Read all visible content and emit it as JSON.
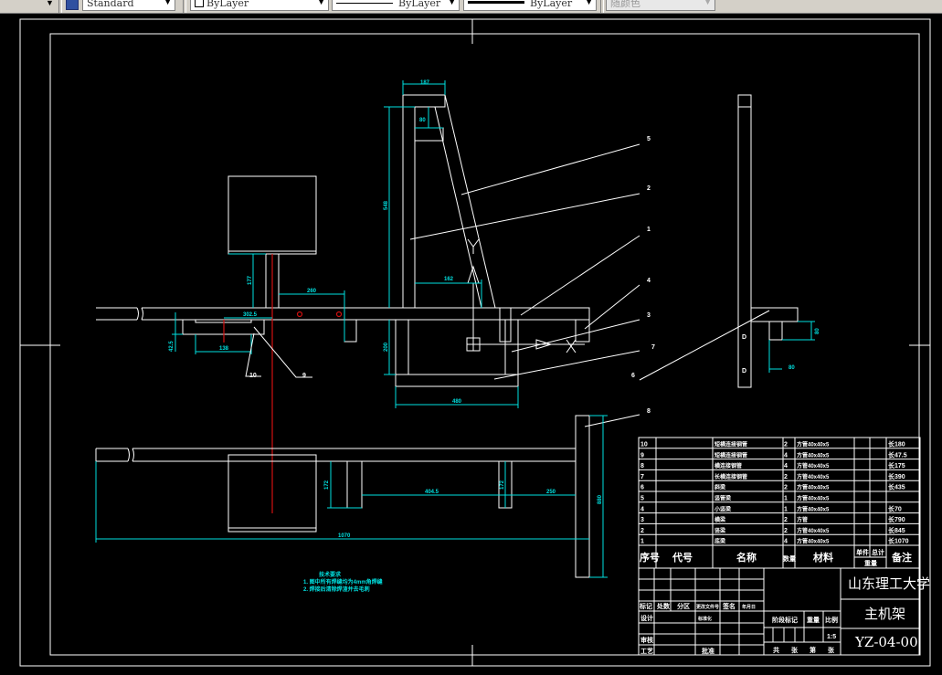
{
  "toolbar": {
    "text_style": "Standard",
    "layer": "ByLayer",
    "linetype": "ByLayer",
    "lineweight": "ByLayer",
    "plot_style": "随颜色"
  },
  "colors": {
    "background": "#000000",
    "object_lines": "#ffffff",
    "dimensions": "#00e0e0",
    "centerline": "#d01010",
    "toolbar": "#d4d0c8"
  },
  "dimensions": {
    "top_width": "187",
    "crossbar_gap": "80",
    "post_height": "548",
    "motor_post": "177",
    "motor_offset": "260",
    "brace_offset": "162",
    "lower_height": "200",
    "lower_width": "480",
    "left_offset": "302.5",
    "left_height": "42.5",
    "left_width": "138",
    "plan_post": "172",
    "plan_post2": "172",
    "plan_span": "404.5",
    "plan_end": "250",
    "plan_total": "1070",
    "plan_depth": "880",
    "side_height": "80",
    "side_width": "80"
  },
  "leaders": [
    "1",
    "2",
    "3",
    "4",
    "5",
    "6",
    "7",
    "8",
    "9",
    "10"
  ],
  "side_marks": [
    "D",
    "D"
  ],
  "notes": {
    "title": "技术要求",
    "items": [
      "1. 图中所有焊缝均为4mm角焊缝",
      "2. 焊接后清除焊渣并去毛刺"
    ]
  },
  "parts_list": {
    "rows": [
      {
        "no": "10",
        "code": "",
        "name": "短横连接钢管",
        "qty": "2",
        "material": "方管40x40x5",
        "unit": "",
        "total": "",
        "remark": "长180"
      },
      {
        "no": "9",
        "code": "",
        "name": "短横连接钢管",
        "qty": "4",
        "material": "方管40x40x5",
        "unit": "",
        "total": "",
        "remark": "长47.5"
      },
      {
        "no": "8",
        "code": "",
        "name": "横连接钢管",
        "qty": "4",
        "material": "方管40x40x5",
        "unit": "",
        "total": "",
        "remark": "长175"
      },
      {
        "no": "7",
        "code": "",
        "name": "长横连接钢管",
        "qty": "2",
        "material": "方管40x40x5",
        "unit": "",
        "total": "",
        "remark": "长390"
      },
      {
        "no": "6",
        "code": "",
        "name": "斜梁",
        "qty": "2",
        "material": "方管40x40x5",
        "unit": "",
        "total": "",
        "remark": "长435"
      },
      {
        "no": "5",
        "code": "",
        "name": "竖管梁",
        "qty": "1",
        "material": "方管40x40x5",
        "unit": "",
        "total": "",
        "remark": ""
      },
      {
        "no": "4",
        "code": "",
        "name": "小竖梁",
        "qty": "1",
        "material": "方管40x40x5",
        "unit": "",
        "total": "",
        "remark": "长70"
      },
      {
        "no": "3",
        "code": "",
        "name": "横梁",
        "qty": "2",
        "material": "方管",
        "unit": "",
        "total": "",
        "remark": "长790"
      },
      {
        "no": "2",
        "code": "",
        "name": "竖梁",
        "qty": "2",
        "material": "方管40x40x5",
        "unit": "",
        "total": "",
        "remark": "长845"
      },
      {
        "no": "1",
        "code": "",
        "name": "底梁",
        "qty": "4",
        "material": "方管40x40x5",
        "unit": "",
        "total": "",
        "remark": "长1070"
      }
    ],
    "header": {
      "no": "序号",
      "code": "代号",
      "name": "名称",
      "qty": "数量",
      "material": "材料",
      "unit": "单件",
      "total": "总计",
      "weight": "重量",
      "remark": "备注"
    }
  },
  "title_block": {
    "school": "山东理工大学",
    "drawing_name": "主机架",
    "drawing_no": "YZ-04-00",
    "scale": "1:5",
    "rev_labels": [
      "标记",
      "处数",
      "分区",
      "更改文件号",
      "签名",
      "年月日"
    ],
    "design": "设计",
    "standard": "标准化",
    "review": "审核",
    "process": "工艺",
    "approve": "批准",
    "stage": "阶段标记",
    "weight": "重量",
    "scale_label": "比例",
    "sheet_total": "共",
    "sheet_unit": "张",
    "sheet_no": "第",
    "sheet_unit2": "张"
  }
}
